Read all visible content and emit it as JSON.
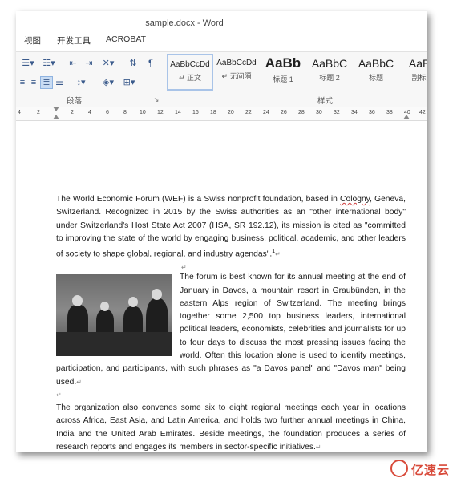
{
  "window": {
    "title": "sample.docx - Word"
  },
  "menu": {
    "items": [
      "视图",
      "开发工具",
      "ACROBAT"
    ]
  },
  "ribbon": {
    "paragraph_group_label": "段落",
    "styles_group_label": "样式",
    "styles": [
      {
        "sample": "AaBbCcDd",
        "name": "↵ 正文"
      },
      {
        "sample": "AaBbCcDd",
        "name": "↵ 无间隔"
      },
      {
        "sample": "AaBb",
        "name": "标题 1"
      },
      {
        "sample": "AaBbC",
        "name": "标题 2"
      },
      {
        "sample": "AaBbC",
        "name": "标题"
      },
      {
        "sample": "AaBb",
        "name": "副标题"
      }
    ]
  },
  "ruler": {
    "ticks": [
      "4",
      "2",
      "2",
      "4",
      "6",
      "8",
      "10",
      "12",
      "14",
      "16",
      "18",
      "20",
      "22",
      "24",
      "26",
      "28",
      "30",
      "32",
      "34",
      "36",
      "38",
      "40",
      "42"
    ]
  },
  "document": {
    "p1_part1": "The World Economic Forum (WEF) is a Swiss nonprofit foundation, based in ",
    "p1_squiggle": "Cologny",
    "p1_part2": ", Geneva, Switzerland. Recognized in 2015 by the Swiss authorities as an \"other international body\" under Switzerland's Host State Act 2007 (HSA, SR 192.12), its mission is cited as \"committed to improving the state of the world by engaging business, political, academic, and other leaders of society to shape global, regional, and industry agendas\".",
    "p1_footnote": "1",
    "p2": "The forum is best known for its annual meeting at the end of January in Davos, a mountain resort in Graubünden, in the eastern Alps region of Switzerland. The meeting brings together some 2,500 top business leaders, international political leaders, economists, celebrities and journalists for up to four days to discuss the most pressing issues facing the world. Often this location alone is used to identify meetings, participation, and participants, with such phrases as \"a Davos panel\" and \"Davos man\" being used.",
    "p3": "The organization also convenes some six to eight regional meetings each year in locations across Africa, East Asia, and Latin America, and holds two further annual meetings in China, India and the United Arab Emirates. Beside meetings, the foundation produces a series of research reports and engages its members in sector-specific initiatives.",
    "para_mark": "↵"
  },
  "watermark": {
    "text": "亿速云"
  }
}
